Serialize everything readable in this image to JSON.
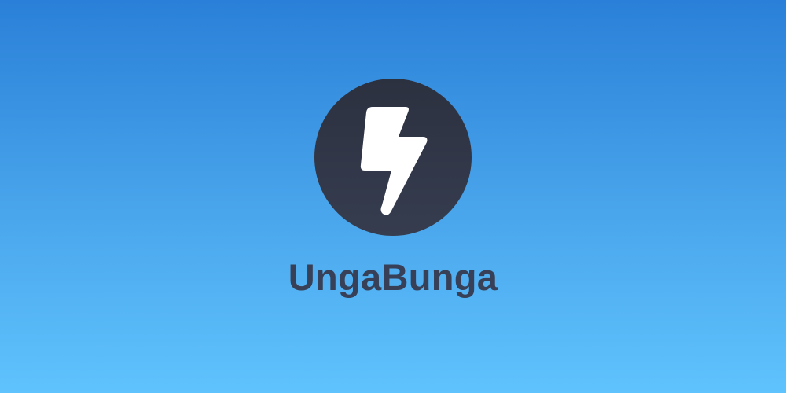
{
  "brand": {
    "name": "UngaBunga",
    "icon": "lightning-bolt-icon",
    "colors": {
      "background_top": "#2a80d8",
      "background_bottom": "#5fc3fd",
      "circle": "#2f3545",
      "bolt": "#ffffff",
      "text": "#374056"
    }
  }
}
